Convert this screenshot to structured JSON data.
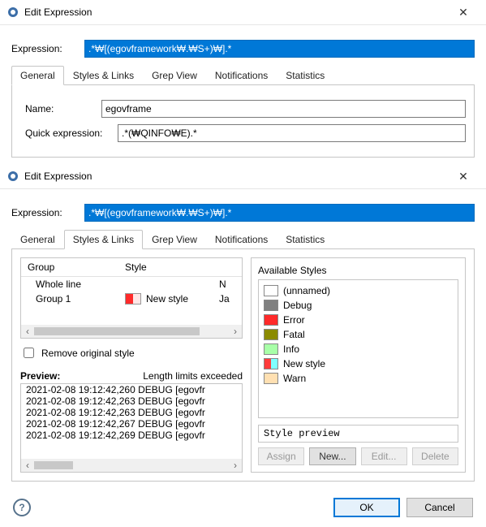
{
  "dialog1": {
    "title": "Edit Expression",
    "expression_label": "Expression:",
    "expression_value": ".*₩[(egovframework₩.₩S+)₩].*",
    "tabs": [
      "General",
      "Styles & Links",
      "Grep View",
      "Notifications",
      "Statistics"
    ],
    "active_tab": 0,
    "general": {
      "name_label": "Name:",
      "name_value": "egovframe",
      "quick_label": "Quick expression:",
      "quick_value": ".*(₩QINFO₩E).*"
    }
  },
  "dialog2": {
    "title": "Edit Expression",
    "expression_label": "Expression:",
    "expression_value": ".*₩[(egovframework₩.₩S+)₩].*",
    "tabs": [
      "General",
      "Styles & Links",
      "Grep View",
      "Notifications",
      "Statistics"
    ],
    "active_tab": 1,
    "group_table": {
      "headers": {
        "group": "Group",
        "style": "Style"
      },
      "rows": [
        {
          "group": "Whole line",
          "style": "",
          "extra": "N"
        },
        {
          "group": "Group 1",
          "style": "New style",
          "extra": "Ja"
        }
      ]
    },
    "remove_original_label": "Remove original style",
    "preview": {
      "label": "Preview:",
      "limits": "Length limits exceeded",
      "lines": [
        "2021-02-08 19:12:42,260 DEBUG [egovfr",
        "2021-02-08 19:12:42,263 DEBUG [egovfr",
        "2021-02-08 19:12:42,263 DEBUG [egovfr",
        "2021-02-08 19:12:42,267 DEBUG [egovfr",
        "2021-02-08 19:12:42,269 DEBUG [egovfr"
      ]
    },
    "available": {
      "title": "Available Styles",
      "items": [
        {
          "name": "(unnamed)",
          "color": "#ffffff"
        },
        {
          "name": "Debug",
          "color": "#808080"
        },
        {
          "name": "Error",
          "color": "#ff2a2a"
        },
        {
          "name": "Fatal",
          "color": "#8b8b00"
        },
        {
          "name": "Info",
          "color": "#a8ffa8"
        },
        {
          "name": "New style",
          "color": "#ff3b3b",
          "accent": "#7fffff"
        },
        {
          "name": "Warn",
          "color": "#ffe0b2"
        }
      ],
      "preview_text": "Style preview",
      "buttons": {
        "assign": "Assign",
        "new": "New...",
        "edit": "Edit...",
        "delete": "Delete"
      }
    }
  },
  "footer": {
    "ok": "OK",
    "cancel": "Cancel"
  }
}
